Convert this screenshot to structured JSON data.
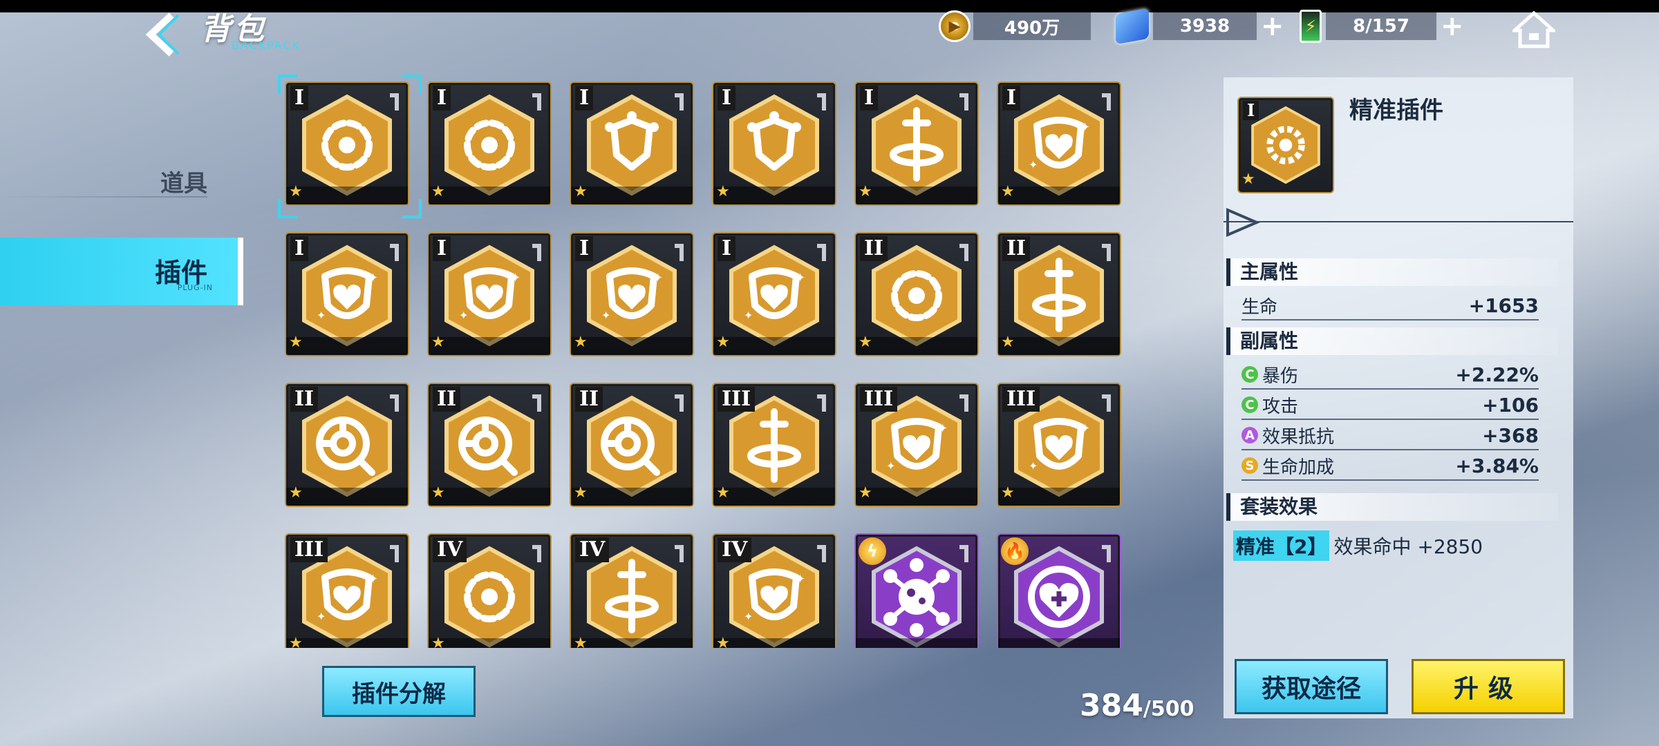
{
  "header": {
    "title": "背包",
    "subtitle": "BACKPACK"
  },
  "resources": {
    "gold": "490万",
    "crystal": "3938",
    "stamina": "8/157"
  },
  "sidebar": {
    "items": [
      {
        "label": "道具",
        "selected": false
      },
      {
        "label": "插件",
        "selected": true,
        "sub": "PLUG-IN"
      }
    ]
  },
  "grid": {
    "cells": [
      {
        "tier": "I",
        "icon": "gear-icon",
        "rarity": "gold"
      },
      {
        "tier": "I",
        "icon": "gear-icon",
        "rarity": "gold"
      },
      {
        "tier": "I",
        "icon": "shield-network-icon",
        "rarity": "gold"
      },
      {
        "tier": "I",
        "icon": "shield-network-icon",
        "rarity": "gold"
      },
      {
        "tier": "I",
        "icon": "sword-swirl-icon",
        "rarity": "gold"
      },
      {
        "tier": "I",
        "icon": "heart-shield-icon",
        "rarity": "gold"
      },
      {
        "tier": "I",
        "icon": "heart-shield-icon",
        "rarity": "gold"
      },
      {
        "tier": "I",
        "icon": "heart-shield-icon",
        "rarity": "gold"
      },
      {
        "tier": "I",
        "icon": "heart-shield-icon",
        "rarity": "gold"
      },
      {
        "tier": "I",
        "icon": "heart-shield-icon",
        "rarity": "gold"
      },
      {
        "tier": "II",
        "icon": "gear-icon",
        "rarity": "gold"
      },
      {
        "tier": "II",
        "icon": "sword-swirl-icon",
        "rarity": "gold"
      },
      {
        "tier": "II",
        "icon": "target-search-icon",
        "rarity": "gold"
      },
      {
        "tier": "II",
        "icon": "target-search-icon",
        "rarity": "gold"
      },
      {
        "tier": "II",
        "icon": "target-search-icon",
        "rarity": "gold"
      },
      {
        "tier": "III",
        "icon": "sword-swirl-icon",
        "rarity": "gold"
      },
      {
        "tier": "III",
        "icon": "heart-shield-icon",
        "rarity": "gold"
      },
      {
        "tier": "III",
        "icon": "heart-shield-icon",
        "rarity": "gold"
      },
      {
        "tier": "III",
        "icon": "heart-shield-icon",
        "rarity": "gold"
      },
      {
        "tier": "IV",
        "icon": "gear-icon",
        "rarity": "gold"
      },
      {
        "tier": "IV",
        "icon": "sword-swirl-icon",
        "rarity": "gold"
      },
      {
        "tier": "IV",
        "icon": "heart-shield-icon",
        "rarity": "gold"
      },
      {
        "tier": "",
        "icon": "virus-icon",
        "rarity": "purple",
        "element": "lightning-icon"
      },
      {
        "tier": "",
        "icon": "heart-plus-icon",
        "rarity": "purple",
        "element": "fire-icon"
      }
    ]
  },
  "decompose_button": "插件分解",
  "capacity": {
    "current": "384",
    "max": "/500"
  },
  "detail": {
    "name": "精准插件",
    "thumb_tier": "I",
    "main_title": "主属性",
    "main_stat": {
      "label": "生命",
      "value": "+1653"
    },
    "sub_title": "副属性",
    "sub_stats": [
      {
        "grade": "C",
        "color": "#4ec24a",
        "label": "暴伤",
        "value": "+2.22%"
      },
      {
        "grade": "C",
        "color": "#4ec24a",
        "label": "攻击",
        "value": "+106"
      },
      {
        "grade": "A",
        "color": "#b05ae0",
        "label": "效果抵抗",
        "value": "+368"
      },
      {
        "grade": "S",
        "color": "#e8a820",
        "label": "生命加成",
        "value": "+3.84%"
      }
    ],
    "set_title": "套装效果",
    "set_tag": "精准【2】",
    "set_effect": "效果命中 +2850",
    "get_button": "获取途径",
    "upgrade_button": "升级"
  }
}
